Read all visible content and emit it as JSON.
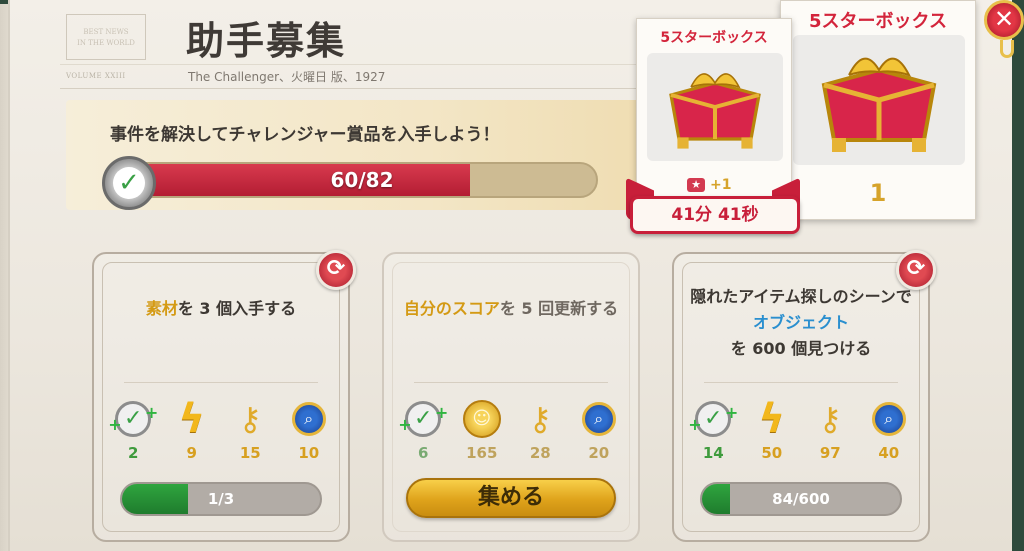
{
  "masthead": {
    "title": "助手募集",
    "subtitle": "The Challenger、火曜日 版、1927"
  },
  "banner": {
    "text": "事件を解決してチャレンジャー賞品を入手しよう！",
    "progress_label": "60/82",
    "progress_current": 60,
    "progress_total": 82
  },
  "boxes": {
    "front": {
      "title": "5スターボックス",
      "bonus": "+1",
      "timer": "41分 41秒"
    },
    "back": {
      "title": "5スターボックス",
      "count": "1"
    }
  },
  "cards": [
    {
      "title_hl": "素材",
      "title_rest": "を 3 個入手する",
      "rewards": [
        {
          "icon": "check-plus-icon",
          "value": "2"
        },
        {
          "icon": "energy-bolt-icon",
          "value": "9"
        },
        {
          "icon": "key-icon",
          "value": "15"
        },
        {
          "icon": "magnifier-badge-icon",
          "value": "10"
        }
      ],
      "bar_label": "1/3",
      "bar_fraction": 0.3333
    },
    {
      "title_hl": "自分のスコア",
      "title_rest": "を 5 回更新する",
      "rewards": [
        {
          "icon": "check-plus-icon",
          "value": "6"
        },
        {
          "icon": "coin-icon",
          "value": "165"
        },
        {
          "icon": "key-icon",
          "value": "28"
        },
        {
          "icon": "magnifier-badge-icon",
          "value": "20"
        }
      ],
      "button_label": "集める"
    },
    {
      "title_pre": "隠れたアイテム探しのシーンで",
      "title_hl": "オブジェクト",
      "title_rest": "を 600 個見つける",
      "rewards": [
        {
          "icon": "check-plus-icon",
          "value": "14"
        },
        {
          "icon": "energy-bolt-icon",
          "value": "50"
        },
        {
          "icon": "key-icon",
          "value": "97"
        },
        {
          "icon": "magnifier-badge-icon",
          "value": "40"
        }
      ],
      "bar_label": "84/600",
      "bar_fraction": 0.14
    }
  ],
  "colors": {
    "accent_red": "#c81f3a",
    "gold": "#d6a32a",
    "progress_green": "#2fa53f",
    "highlight_blue": "#2a8fcf"
  }
}
